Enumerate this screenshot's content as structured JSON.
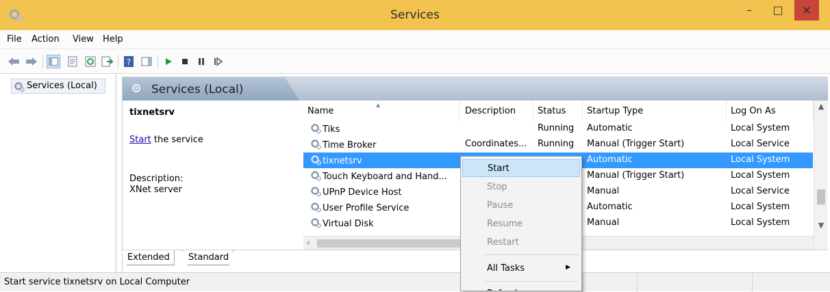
{
  "window": {
    "title": "Services",
    "controls": {
      "minimize": "–",
      "maximize": "□",
      "close": "×"
    }
  },
  "menu": [
    "File",
    "Action",
    "View",
    "Help"
  ],
  "toolbar": {
    "icons": [
      "back-arrow-icon",
      "forward-arrow-icon",
      "show-hide-tree-icon",
      "properties-icon",
      "refresh-icon",
      "export-list-icon",
      "help-icon",
      "show-hide-action-pane-icon",
      "play-icon",
      "stop-icon",
      "pause-icon",
      "resume-icon"
    ]
  },
  "tree": {
    "root_label": "Services (Local)"
  },
  "pane": {
    "header_title": "Services (Local)"
  },
  "extended": {
    "service_name": "tixnetsrv",
    "start_link": "Start",
    "start_suffix": " the service",
    "description_label": "Description:",
    "description_text": "XNet server"
  },
  "columns": [
    "Name",
    "Description",
    "Status",
    "Startup Type",
    "Log On As"
  ],
  "services": [
    {
      "name": "Tiks",
      "description": "",
      "status": "Running",
      "startup": "Automatic",
      "logon": "Local System"
    },
    {
      "name": "Time Broker",
      "description": "Coordinates...",
      "status": "Running",
      "startup": "Manual (Trigger Start)",
      "logon": "Local Service"
    },
    {
      "name": "tixnetsrv",
      "description": "",
      "status": "",
      "startup": "Automatic",
      "logon": "Local System",
      "selected": true
    },
    {
      "name": "Touch Keyboard and Hand...",
      "description": "",
      "status": "",
      "startup": "Manual (Trigger Start)",
      "logon": "Local System"
    },
    {
      "name": "UPnP Device Host",
      "description": "",
      "status": "",
      "startup": "Manual",
      "logon": "Local Service"
    },
    {
      "name": "User Profile Service",
      "description": "",
      "status": "",
      "startup": "Automatic",
      "logon": "Local System"
    },
    {
      "name": "Virtual Disk",
      "description": "",
      "status": "",
      "startup": "Manual",
      "logon": "Local System"
    }
  ],
  "tabs": {
    "extended": "Extended",
    "standard": "Standard"
  },
  "context_menu": {
    "start": "Start",
    "stop": "Stop",
    "pause": "Pause",
    "resume": "Resume",
    "restart": "Restart",
    "all_tasks": "All Tasks",
    "refresh": "Refresh"
  },
  "status_bar": {
    "text": "Start service tixnetsrv on Local Computer"
  },
  "colors": {
    "titlebar": "#f2c34f",
    "selection": "#3399ff",
    "menu_hover": "#cde6f7",
    "close_button": "#c8453a",
    "play_icon": "#1f9b3a"
  }
}
